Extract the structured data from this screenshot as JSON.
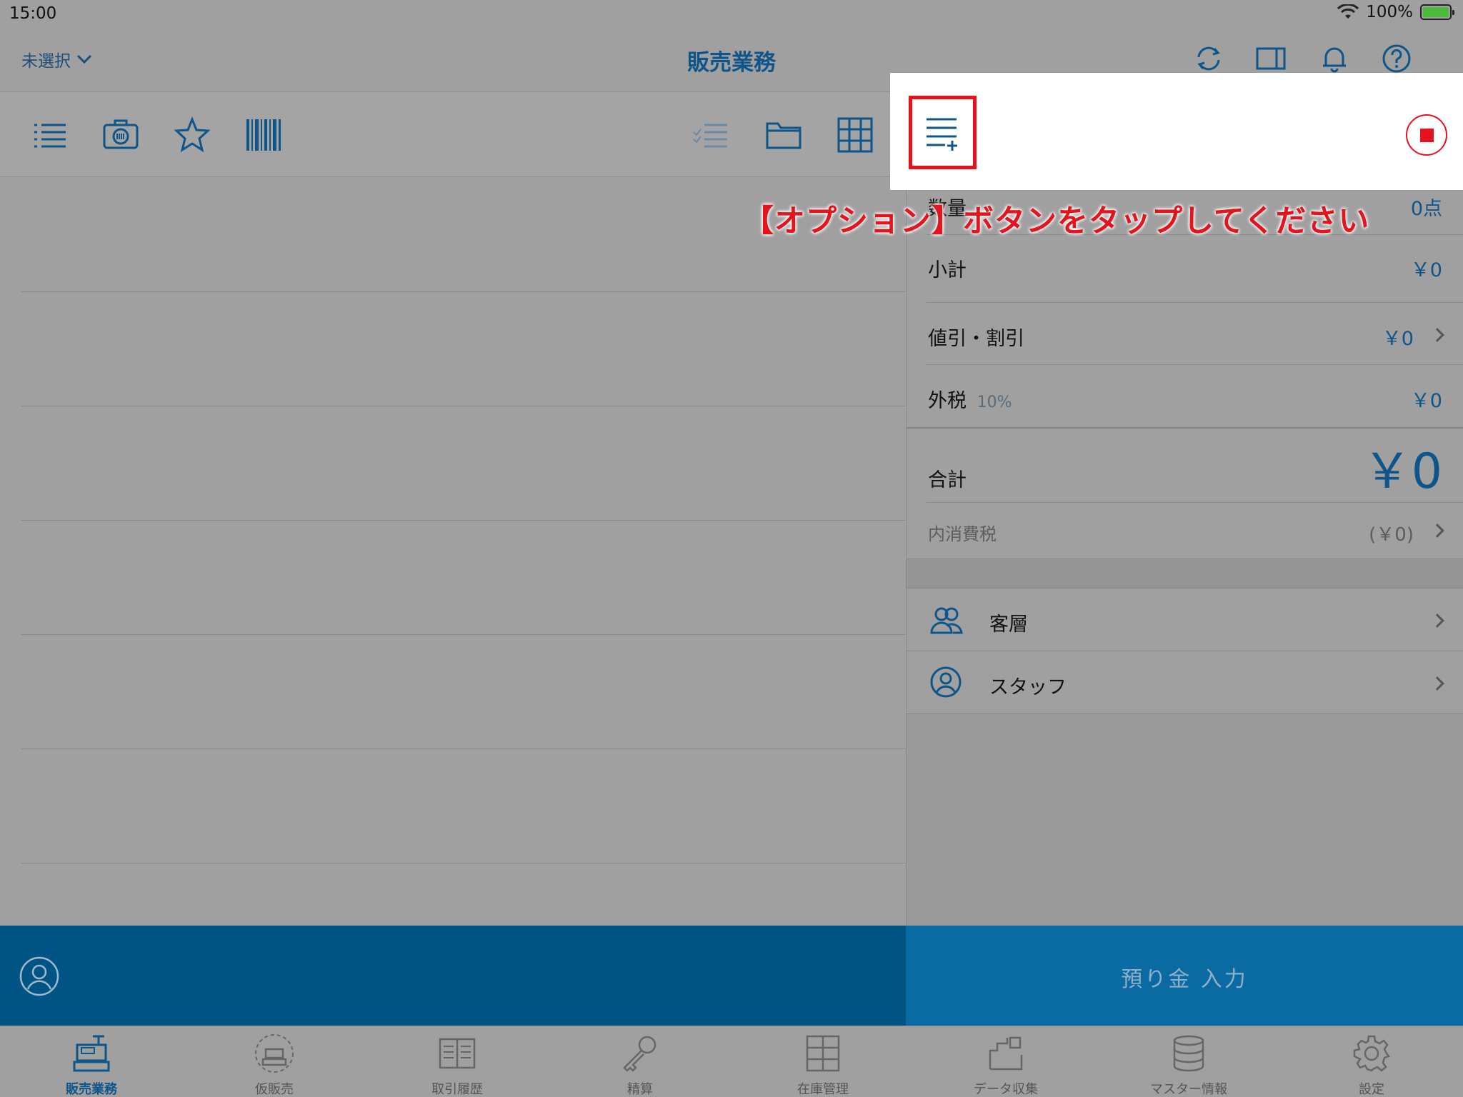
{
  "status_bar": {
    "time": "15:00",
    "battery_percent": "100%"
  },
  "nav": {
    "store_selector": "未選択",
    "title": "販売業務"
  },
  "summary": {
    "quantity_label": "数量",
    "quantity_value": "0点",
    "subtotal_label": "小計",
    "subtotal_value": "￥0",
    "discount_label": "値引・割引",
    "discount_value": "￥0",
    "tax_label": "外税",
    "tax_rate": "10%",
    "tax_value": "￥0",
    "total_label": "合計",
    "total_value": "￥0",
    "internal_tax_label": "内消費税",
    "internal_tax_value": "(￥0)"
  },
  "attributes": {
    "customer_label": "客層",
    "staff_label": "スタッフ"
  },
  "instruction": "【オプション】ボタンをタップしてください",
  "deposit_button": "預り金 入力",
  "tabs": [
    {
      "label": "販売業務",
      "icon": "register-icon"
    },
    {
      "label": "仮販売",
      "icon": "temp-sale-icon"
    },
    {
      "label": "取引履歴",
      "icon": "history-book-icon"
    },
    {
      "label": "精算",
      "icon": "key-icon"
    },
    {
      "label": "在庫管理",
      "icon": "cabinet-icon"
    },
    {
      "label": "データ収集",
      "icon": "data-collect-icon"
    },
    {
      "label": "マスター情報",
      "icon": "database-icon"
    },
    {
      "label": "設定",
      "icon": "gear-icon"
    }
  ],
  "colors": {
    "brand_blue": "#0e5589",
    "highlight_red": "#e3141e",
    "bottom_bar": "#005585"
  }
}
